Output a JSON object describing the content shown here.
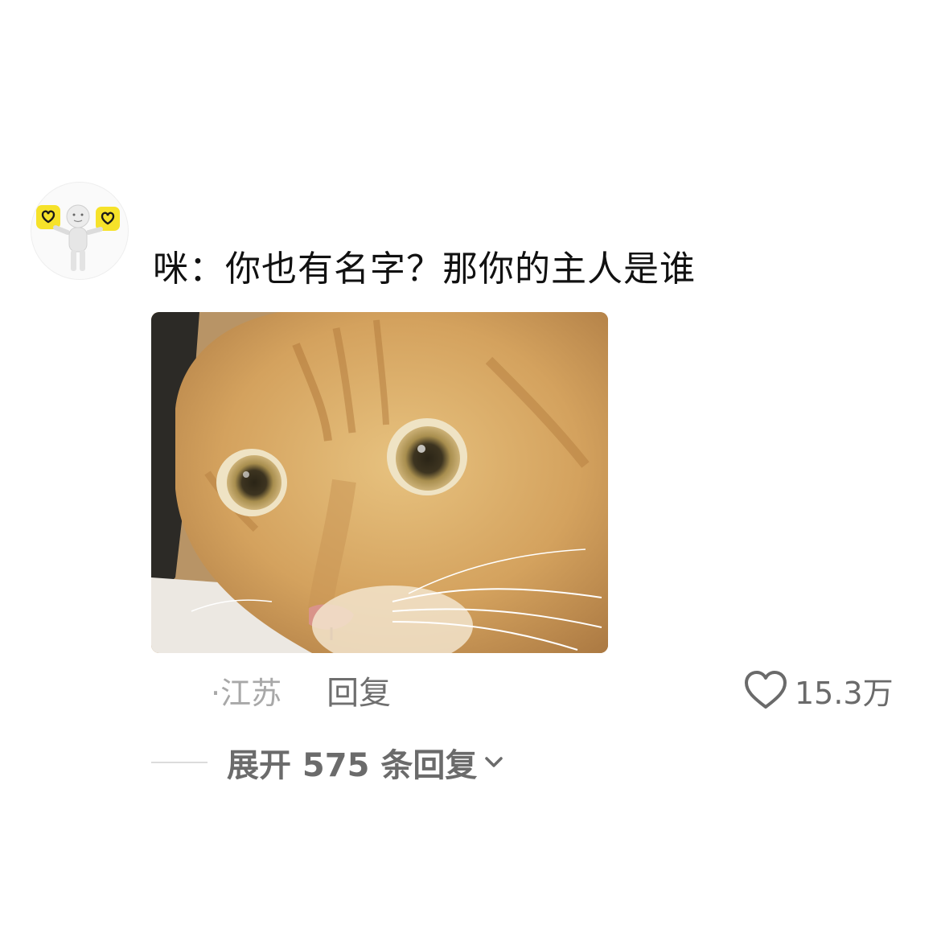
{
  "comment": {
    "text": "咪：你也有名字？那你的主人是谁",
    "avatar_icon": "figure-holding-heart-signs-icon",
    "image_icon": "orange-tabby-cat-photo"
  },
  "meta": {
    "location": "·江苏",
    "reply_label": "回复",
    "like_icon": "heart-outline-icon",
    "like_count": "15.3万"
  },
  "expand": {
    "label": "展开 575 条回复",
    "chevron_icon": "chevron-down-icon"
  },
  "colors": {
    "background": "#ffffff",
    "text_primary": "#111111",
    "text_secondary": "#6b6b6b",
    "text_muted": "#a8a8a8",
    "avatar_accent": "#f6e22a"
  }
}
